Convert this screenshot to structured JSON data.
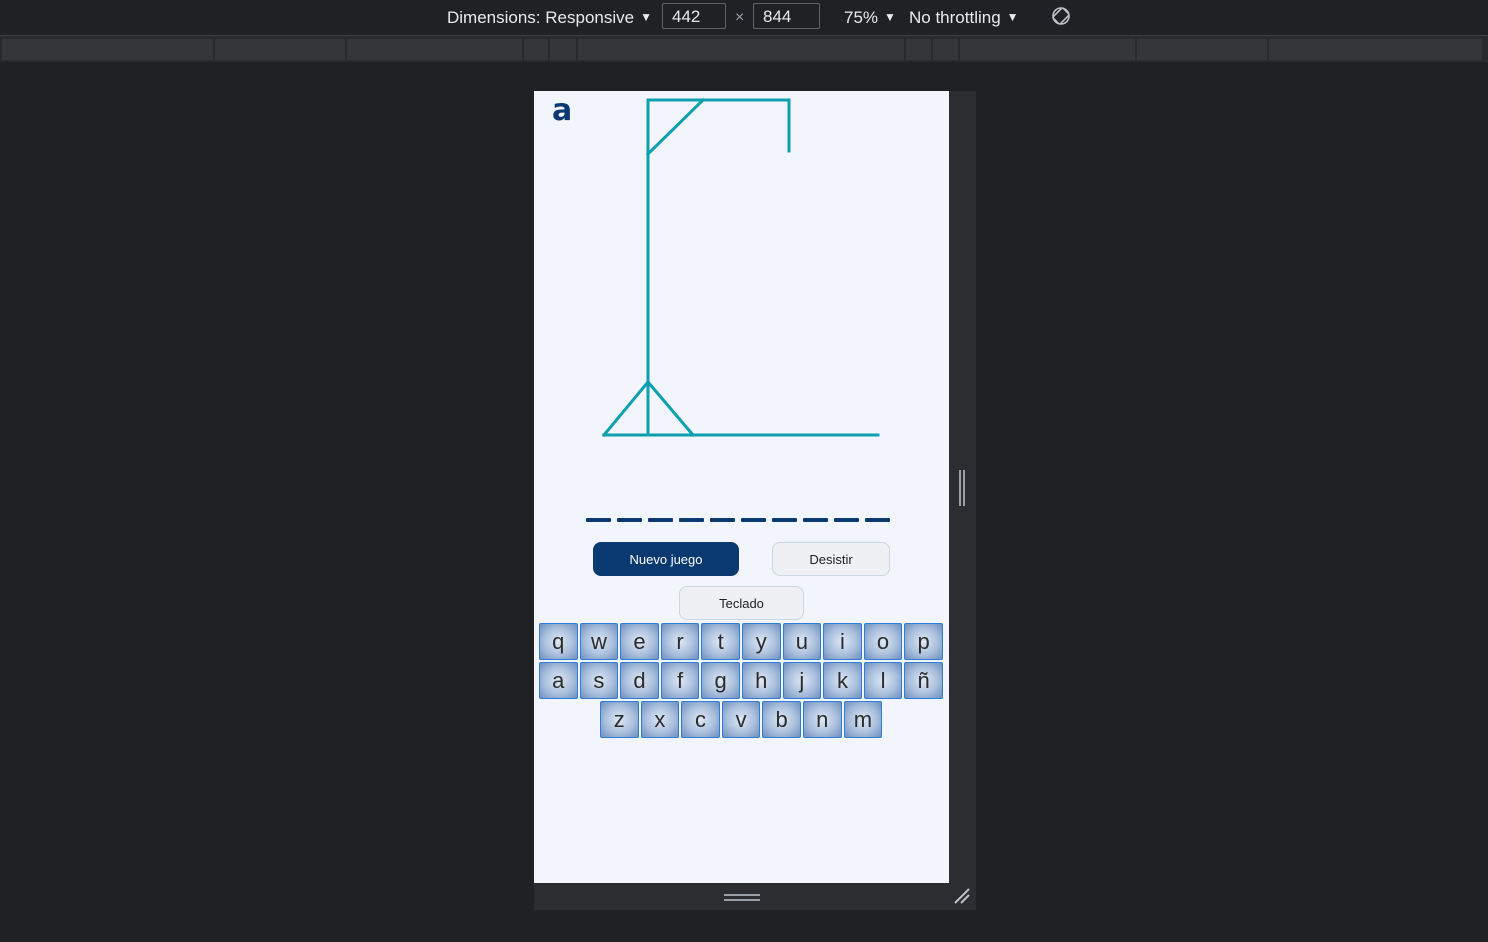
{
  "devtools": {
    "dimensions_label": "Dimensions: Responsive",
    "width_value": "442",
    "times_symbol": "×",
    "height_value": "844",
    "zoom_label": "75%",
    "throttling_label": "No throttling",
    "caret": "▼",
    "icons": {
      "rotate": "rotate-icon",
      "resize_handle": "drag-handle-icon",
      "corner_resize": "corner-resize-icon"
    }
  },
  "game": {
    "logo": "a",
    "word_length": 10,
    "buttons": {
      "new_game": "Nuevo juego",
      "give_up": "Desistir",
      "keyboard": "Teclado"
    },
    "keyboard": {
      "rows": [
        [
          "q",
          "w",
          "e",
          "r",
          "t",
          "y",
          "u",
          "i",
          "o",
          "p"
        ],
        [
          "a",
          "s",
          "d",
          "f",
          "g",
          "h",
          "j",
          "k",
          "l",
          "ñ"
        ],
        [
          "z",
          "x",
          "c",
          "v",
          "b",
          "n",
          "m"
        ]
      ]
    },
    "colors": {
      "primary": "#0a3871",
      "gallows": "#0fa0b0",
      "background": "#f3f5fc",
      "key_border": "#2e7fd3"
    }
  }
}
